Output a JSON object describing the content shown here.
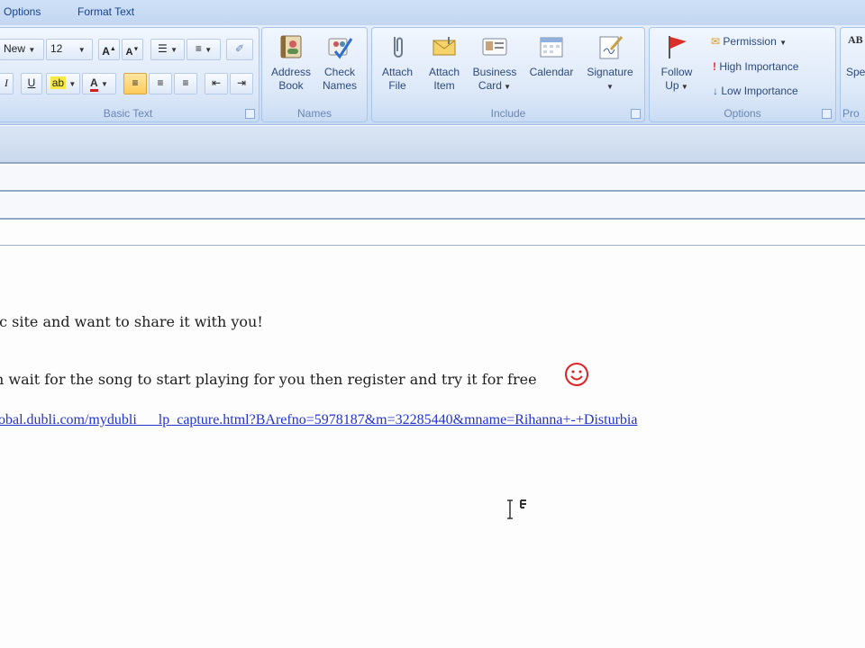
{
  "tabs": [
    {
      "label": "Options"
    },
    {
      "label": "Format Text"
    }
  ],
  "basic_text": {
    "font_name": "New",
    "font_size": "12",
    "group_label": "Basic Text"
  },
  "names": {
    "address_book": [
      "Address",
      "Book"
    ],
    "check_names": [
      "Check",
      "Names"
    ],
    "group_label": "Names"
  },
  "include": {
    "attach_file": [
      "Attach",
      "File"
    ],
    "attach_item": [
      "Attach",
      "Item"
    ],
    "business_card": [
      "Business",
      "Card"
    ],
    "calendar": "Calendar",
    "signature": "Signature",
    "group_label": "Include"
  },
  "options": {
    "follow_up": [
      "Follow",
      "Up"
    ],
    "permission": "Permission",
    "high_importance": "High Importance",
    "low_importance": "Low Importance",
    "group_label": "Options"
  },
  "proofing": {
    "button_partial": "Spe",
    "group_partial": "Pro"
  },
  "message": {
    "line1": "ic site and want to share it with you!",
    "line2": "n wait for the song to start playing for you then register and try it for free",
    "link": "obal.dubli.com/mydubli___lp_capture.html?BArefno=5978187&m=32285440&mname=Rihanna+-+Disturbia"
  },
  "colors": {
    "ribbon_text": "#2c4a7c",
    "link": "#2233cc",
    "highlight": "#ffca5a",
    "font_color_a": "#d02020"
  }
}
